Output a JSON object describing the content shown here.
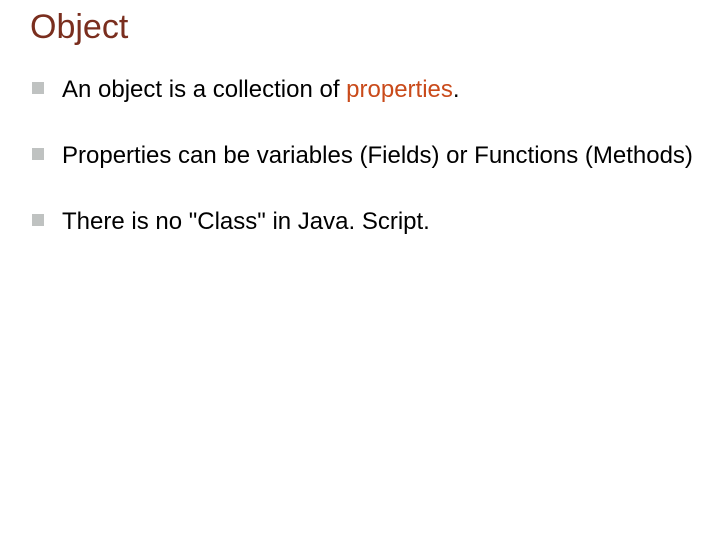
{
  "title": "Object",
  "bullets": [
    {
      "pre": "An object is a collection of ",
      "accent": "properties",
      "post": "."
    },
    {
      "pre": "Properties can be variables (Fields) or Functions (Methods)",
      "accent": "",
      "post": ""
    },
    {
      "pre": "There is no \"Class\" in Java. Script.",
      "accent": "",
      "post": ""
    }
  ]
}
